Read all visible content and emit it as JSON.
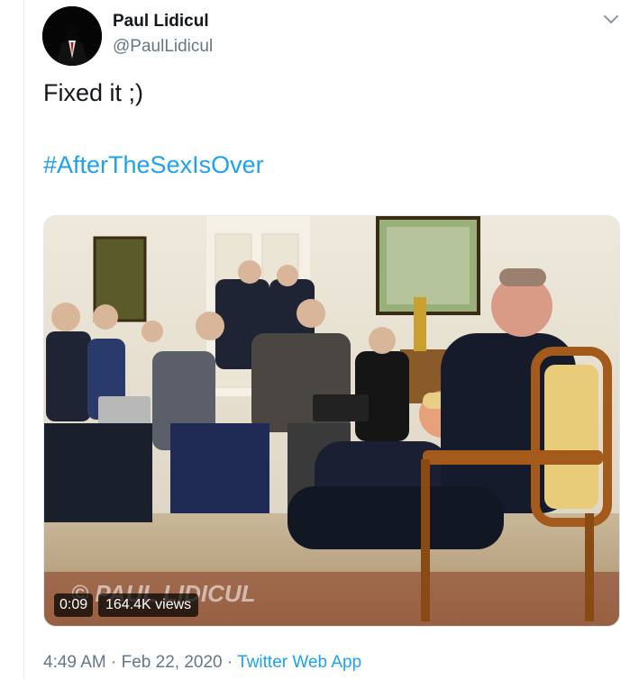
{
  "author": {
    "name": "Paul Lidicul",
    "handle": "@PaulLidicul"
  },
  "tweet": {
    "text": "Fixed it ;)",
    "hashtag": "#AfterTheSexIsOver"
  },
  "media": {
    "watermark": "© PAUL LIDICUL",
    "duration": "0:09",
    "views": "164.4K views"
  },
  "meta": {
    "time": "4:49 AM",
    "separator": "·",
    "date": "Feb 22, 2020",
    "source": "Twitter Web App"
  },
  "colors": {
    "link": "#1da1f2",
    "secondary_text": "#657786",
    "primary_text": "#14171a"
  },
  "icons": {
    "more": "chevron-down-icon"
  }
}
